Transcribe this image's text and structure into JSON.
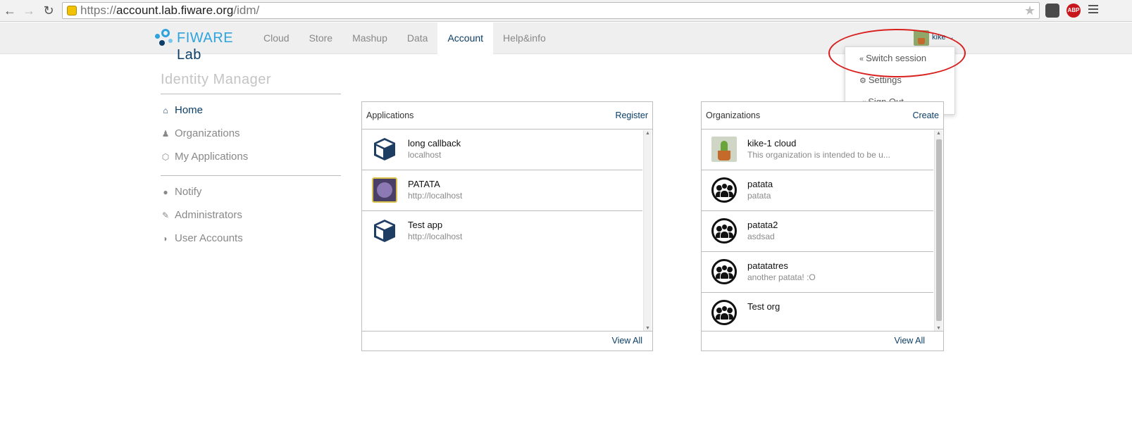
{
  "browser": {
    "url_scheme": "https://",
    "url_host": "account.lab.fiware.org",
    "url_path": "/idm/",
    "back_icon": "arrow-left-icon",
    "forward_icon": "arrow-right-icon",
    "reload_icon": "reload-icon",
    "abp_label": "ABP"
  },
  "logo": {
    "fiware": "FIWARE",
    "lab": "Lab"
  },
  "topnav": {
    "items": [
      {
        "label": "Cloud"
      },
      {
        "label": "Store"
      },
      {
        "label": "Mashup"
      },
      {
        "label": "Data"
      },
      {
        "label": "Account"
      },
      {
        "label": "Help&info"
      }
    ]
  },
  "user": {
    "name": "kike ⌄"
  },
  "dropdown": {
    "items": [
      {
        "icon": "«",
        "label": "Switch session"
      },
      {
        "icon": "⚙",
        "label": "Settings"
      },
      {
        "icon": "⇥",
        "label": "Sign Out"
      }
    ]
  },
  "sidebar": {
    "title": "Identity Manager",
    "items": [
      {
        "icon": "⌂",
        "label": "Home"
      },
      {
        "icon": "♟",
        "label": "Organizations"
      },
      {
        "icon": "⬡",
        "label": "My Applications"
      },
      {
        "icon": "●",
        "label": "Notify"
      },
      {
        "icon": "✎",
        "label": "Administrators"
      },
      {
        "icon": "◗",
        "label": "User Accounts"
      }
    ]
  },
  "applications": {
    "title": "Applications",
    "action": "Register",
    "view_all": "View All",
    "rows": [
      {
        "title": "long callback",
        "subtitle": "localhost"
      },
      {
        "title": "PATATA",
        "subtitle": "http://localhost"
      },
      {
        "title": "Test app",
        "subtitle": "http://localhost"
      }
    ]
  },
  "organizations": {
    "title": "Organizations",
    "action": "Create",
    "view_all": "View All",
    "rows": [
      {
        "title": "kike-1 cloud",
        "subtitle": "This organization is intended to be u..."
      },
      {
        "title": "patata",
        "subtitle": "patata"
      },
      {
        "title": "patata2",
        "subtitle": "asdsad"
      },
      {
        "title": "patatatres",
        "subtitle": "another patata! :O"
      },
      {
        "title": "Test org",
        "subtitle": ""
      }
    ]
  },
  "colors": {
    "brand_dark": "#0c3e67",
    "brand_light": "#2ea3dc",
    "annotation": "#d8201f"
  }
}
